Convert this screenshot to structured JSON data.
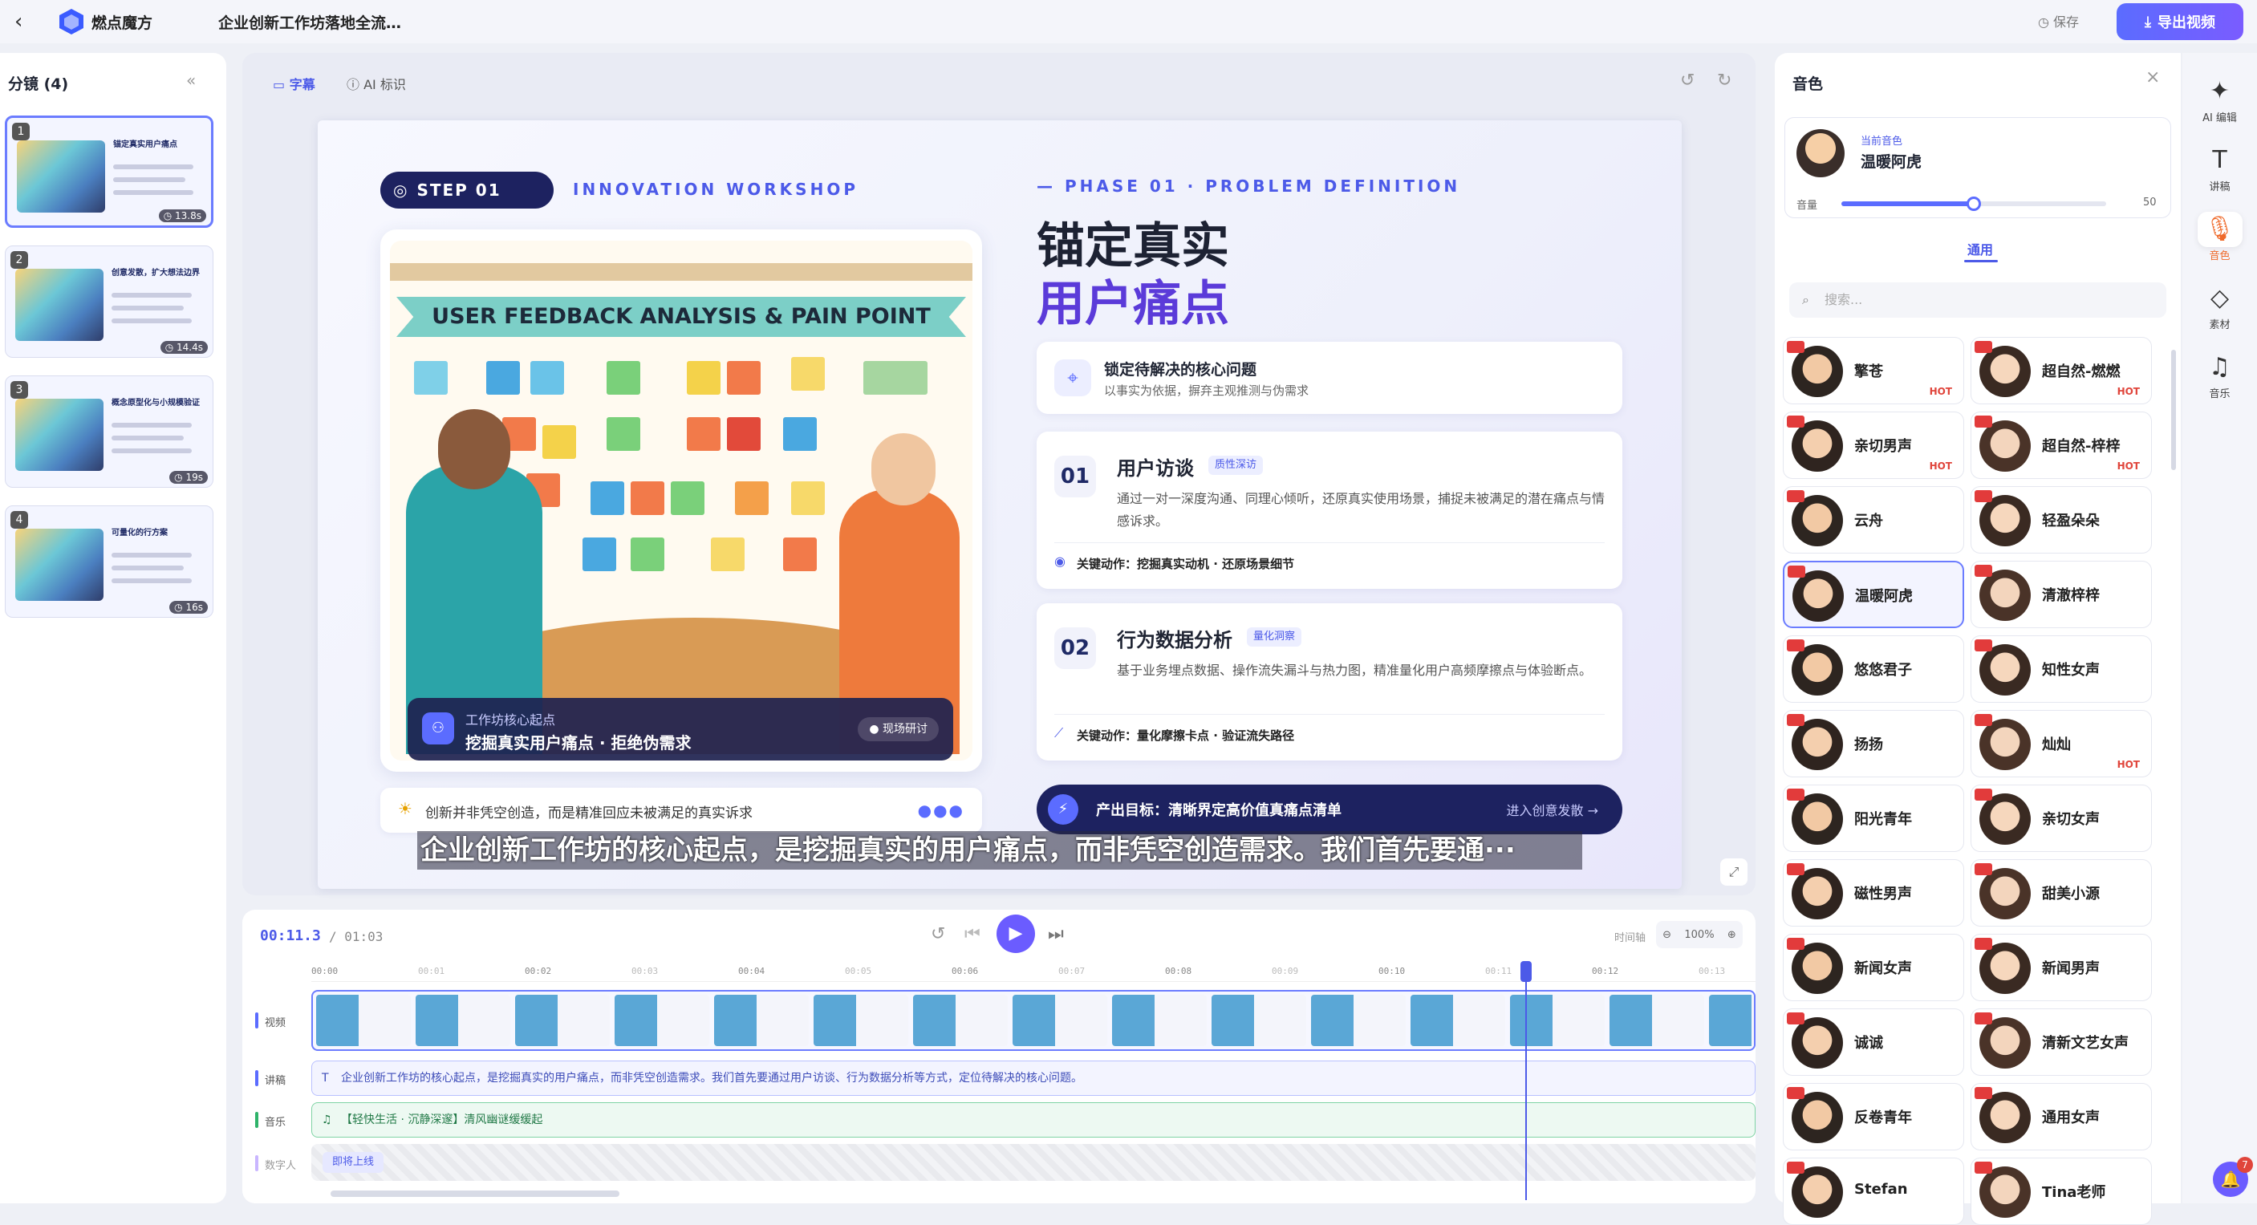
{
  "topbar": {
    "app_name": "燃点魔方",
    "doc_title": "企业创新工作坊落地全流…",
    "save_label": "保存",
    "export_label": "导出视频"
  },
  "storyboard": {
    "title": "分镜 (4)",
    "slides": [
      {
        "num": "1",
        "duration": "13.8s",
        "title": "锚定真实用户痛点",
        "active": true
      },
      {
        "num": "2",
        "duration": "14.4s",
        "title": "创意发散，扩大想法边界",
        "active": false
      },
      {
        "num": "3",
        "duration": "19s",
        "title": "概念原型化与小规模验证",
        "active": false
      },
      {
        "num": "4",
        "duration": "16s",
        "title": "可量化的行方案",
        "active": false
      }
    ]
  },
  "editor": {
    "tab_subtitle": "字幕",
    "tab_ai": "AI 标识"
  },
  "slide": {
    "step": "STEP 01",
    "workshop": "INNOVATION WORKSHOP",
    "illustration_banner": "USER FEEDBACK ANALYSIS & PAIN POINT DISCUSSION",
    "caption_small": "工作坊核心起点",
    "caption_main": "挖掘真实用户痛点 · 拒绝伪需求",
    "caption_tag": "● 现场研讨",
    "quote": "创新并非凭空创造，而是精准回应未被满足的真实诉求",
    "phase": "— PHASE 01 · PROBLEM DEFINITION",
    "heading_line1": "锚定真实",
    "heading_line2": "用户痛点",
    "core_title": "锁定待解决的核心问题",
    "core_desc": "以事实为依据，摒弃主观推测与伪需求",
    "cards": [
      {
        "no": "01",
        "title": "用户访谈",
        "tag": "质性深访",
        "desc": "通过一对一深度沟通、同理心倾听，还原真实使用场景，捕捉未被满足的潜在痛点与情感诉求。",
        "action": "关键动作：挖掘真实动机 · 还原场景细节"
      },
      {
        "no": "02",
        "title": "行为数据分析",
        "tag": "量化洞察",
        "desc": "基于业务埋点数据、操作流失漏斗与热力图，精准量化用户高频摩擦点与体验断点。",
        "action": "关键动作：量化摩擦卡点 · 验证流失路径"
      }
    ],
    "goal": "产出目标：清晰界定高价值真痛点清单",
    "goal_link": "进入创意发散 →",
    "subtitle": "企业创新工作坊的核心起点，是挖掘真实的用户痛点，而非凭空创造需求。我们首先要通···"
  },
  "timeline": {
    "current": "00:11.3",
    "total": "/ 01:03",
    "axis_label": "时间轴",
    "zoom": "100%",
    "ticks": [
      "00:00",
      "00:01",
      "00:02",
      "00:03",
      "00:04",
      "00:05",
      "00:06",
      "00:07",
      "00:08",
      "00:09",
      "00:10",
      "00:11",
      "00:12",
      "00:13"
    ],
    "track_video": "视频",
    "track_narration": "讲稿",
    "track_music": "音乐",
    "track_digital": "数字人",
    "narration_text": "企业创新工作坊的核心起点，是挖掘真实的用户痛点，而非凭空创造需求。我们首先要通过用户访谈、行为数据分析等方式，定位待解决的核心问题。",
    "music_text": "【轻快生活 · 沉静深邃】清风幽谜缓缓起",
    "digital_btn": "即将上线"
  },
  "voice_panel": {
    "title": "音色",
    "current_label": "当前音色",
    "current_name": "温暖阿虎",
    "volume_label": "音量",
    "volume_value": "50",
    "volume_fraction": 0.5,
    "tab": "通用",
    "search_placeholder": "搜索...",
    "voices": [
      {
        "name": "擎苍",
        "hot": "HOT"
      },
      {
        "name": "超自然-燃燃",
        "hot": "HOT"
      },
      {
        "name": "亲切男声",
        "hot": "HOT"
      },
      {
        "name": "超自然-梓梓",
        "hot": "HOT"
      },
      {
        "name": "云舟",
        "hot": ""
      },
      {
        "name": "轻盈朵朵",
        "hot": ""
      },
      {
        "name": "温暖阿虎",
        "hot": "",
        "selected": true
      },
      {
        "name": "清澈梓梓",
        "hot": ""
      },
      {
        "name": "悠悠君子",
        "hot": ""
      },
      {
        "name": "知性女声",
        "hot": ""
      },
      {
        "name": "扬扬",
        "hot": ""
      },
      {
        "name": "灿灿",
        "hot": "HOT"
      },
      {
        "name": "阳光青年",
        "hot": ""
      },
      {
        "name": "亲切女声",
        "hot": ""
      },
      {
        "name": "磁性男声",
        "hot": ""
      },
      {
        "name": "甜美小源",
        "hot": ""
      },
      {
        "name": "新闻女声",
        "hot": ""
      },
      {
        "name": "新闻男声",
        "hot": ""
      },
      {
        "name": "诚诚",
        "hot": ""
      },
      {
        "name": "清新文艺女声",
        "hot": ""
      },
      {
        "name": "反卷青年",
        "hot": ""
      },
      {
        "name": "通用女声",
        "hot": ""
      },
      {
        "name": "Stefan",
        "hot": ""
      },
      {
        "name": "Tina老师",
        "hot": ""
      }
    ]
  },
  "rail": [
    {
      "label": "AI 编辑",
      "icon": "✦"
    },
    {
      "label": "讲稿",
      "icon": "T"
    },
    {
      "label": "音色",
      "icon": "🎙",
      "active": true
    },
    {
      "label": "素材",
      "icon": "◇"
    },
    {
      "label": "音乐",
      "icon": "♫"
    }
  ],
  "notifications": {
    "count": "7"
  }
}
